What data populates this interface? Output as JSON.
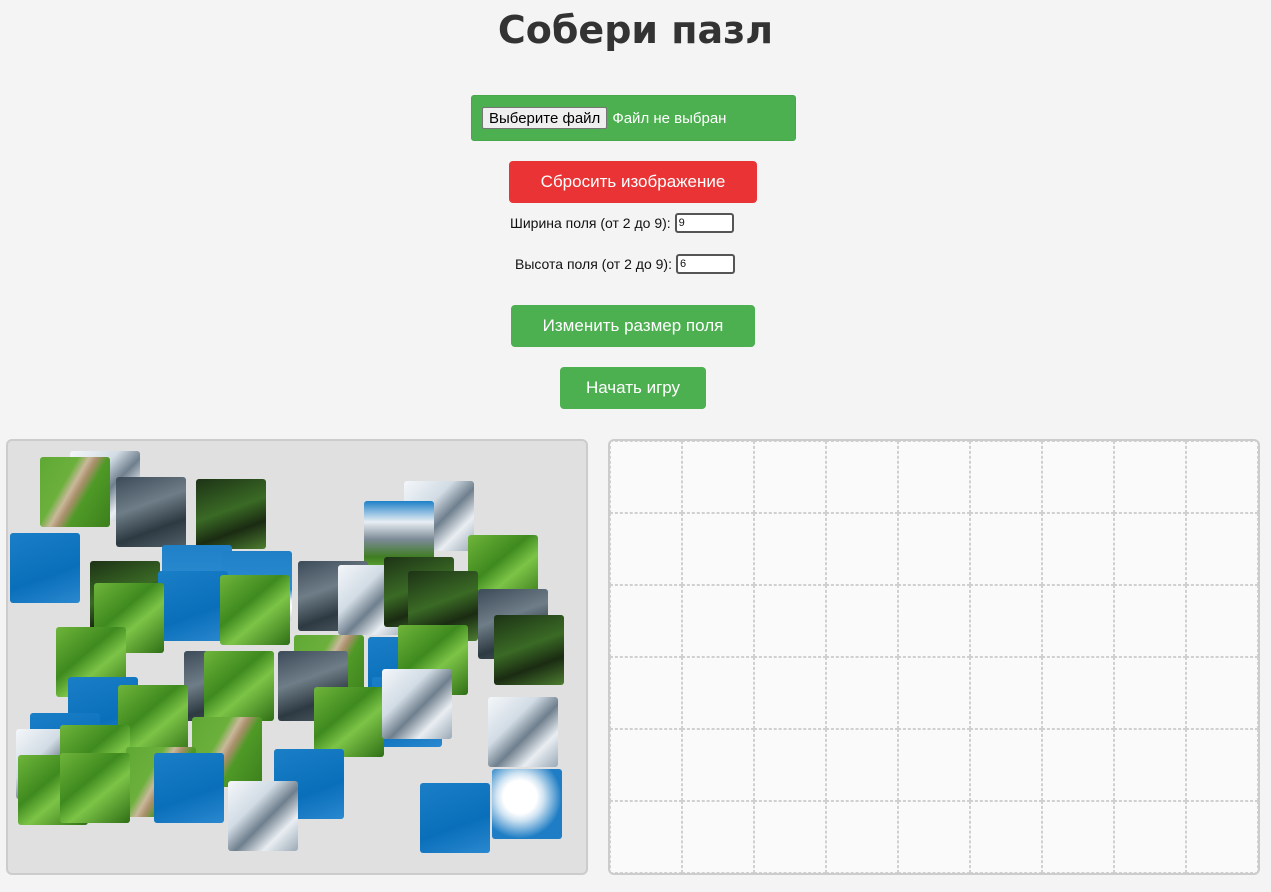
{
  "title": "Собери пазл",
  "file_input": {
    "button_label": "Выберите файл",
    "status": "Файл не выбран"
  },
  "reset_button": "Сбросить изображение",
  "width_field": {
    "label": "Ширина поля (от 2 до 9):",
    "value": "9"
  },
  "height_field": {
    "label": "Высота поля (от 2 до 9):",
    "value": "6"
  },
  "resize_button": "Изменить размер поля",
  "start_button": "Начать игру",
  "board": {
    "columns": 9,
    "rows": 6
  },
  "tray": {
    "piece_count": 54
  }
}
